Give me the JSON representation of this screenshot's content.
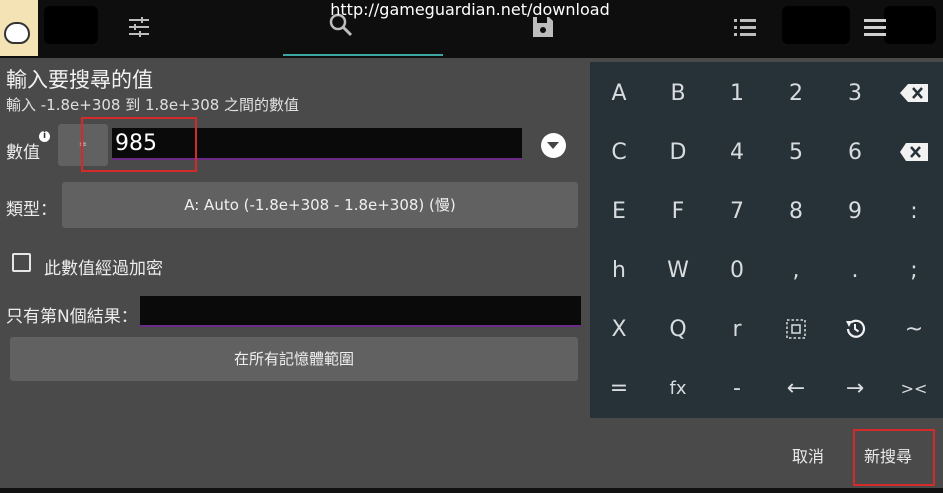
{
  "topbar": {
    "url": "http://gameguardian.net/download",
    "icons": [
      "app-thumbnail",
      "sliders-icon",
      "search-icon",
      "save-icon",
      "list-icon",
      "menu-icon"
    ]
  },
  "dialog": {
    "title": "輸入要搜尋的值",
    "subtitle": "輸入 -1.8e+308 到 1.8e+308 之間的數值",
    "value_label": "數值",
    "info_icon": "i",
    "eq_button": "=",
    "value": "985",
    "type_label": "類型：",
    "type_value": "A: Auto (-1.8e+308 - 1.8e+308) (慢)",
    "encrypted_label": "此數值經過加密",
    "encrypted_checked": false,
    "nth_label": "只有第N個結果：",
    "nth_value": "",
    "range_button": "在所有記憶體範圍"
  },
  "keypad": {
    "rows": [
      [
        "A",
        "B",
        "1",
        "2",
        "3",
        "backspace-icon"
      ],
      [
        "C",
        "D",
        "4",
        "5",
        "6",
        "clear-icon"
      ],
      [
        "E",
        "F",
        "7",
        "8",
        "9",
        ":"
      ],
      [
        "h",
        "W",
        "0",
        ",",
        ".",
        ";"
      ],
      [
        "X",
        "Q",
        "r",
        "select-icon",
        "history-icon",
        "~"
      ],
      [
        "=",
        "fx",
        "-",
        "←",
        "→",
        "><"
      ]
    ]
  },
  "actions": {
    "cancel": "取消",
    "new_search": "新搜尋"
  },
  "colors": {
    "panel_bg": "#4a4a4a",
    "keypad_bg": "#263238",
    "highlight_red": "#d42a2a",
    "accent_underline": "#3ea6a0",
    "input_underline": "#6a2a86"
  }
}
